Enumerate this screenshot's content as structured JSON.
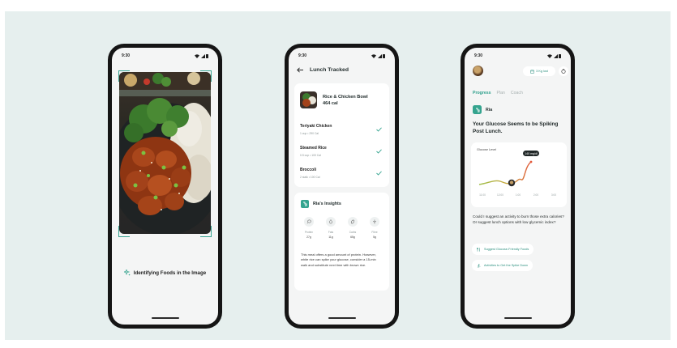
{
  "status_bar": {
    "time": "9:30"
  },
  "phone1": {
    "caption": "Identifying Foods in the Image"
  },
  "phone2": {
    "title": "Lunch Tracked",
    "meal": {
      "name": "Rice & Chicken Bowl",
      "calories": "464 cal"
    },
    "items": [
      {
        "name": "Teriyaki Chicken",
        "meta": "1 cup • 290 Cal"
      },
      {
        "name": "Steamed Rice",
        "meta": "0.5 cup • 100 Cal"
      },
      {
        "name": "Broccoli",
        "meta": "2 stalk • 100 Cal"
      }
    ],
    "insights": {
      "title": "Ria's Insights",
      "macros": [
        {
          "label": "Protein",
          "value": "27g",
          "icon": "drumstick-icon"
        },
        {
          "label": "Fats",
          "value": "11g",
          "icon": "drop-icon"
        },
        {
          "label": "Carbs",
          "value": "65g",
          "icon": "grain-icon"
        },
        {
          "label": "Fibre",
          "value": "5g",
          "icon": "leaf-icon"
        }
      ],
      "text": "This meal offers a good amount of protein. However, white rice can spike your glucose, consider a 15-min walk and substitute next time with brown rice."
    }
  },
  "phone3": {
    "log_label": "3 Kg lost",
    "tabs": [
      "Progress",
      "Plan",
      "Coach"
    ],
    "assistant_name": "Ria",
    "headline": "Your Glucose Seems to be Spiking Post Lunch.",
    "chart_label": "Glucose Level",
    "chart_tooltip": "140 mg/dl",
    "chart_ticks": [
      "11:00",
      "12:00",
      "1:00",
      "2:00",
      "3:00"
    ],
    "question": "Could I suggest an activity to burn those extra calories? Or suggest lunch options with low glycemic index?",
    "actions": [
      "Suggest Glucose-Friendly Foods",
      "Activities to Get the Spike Down"
    ]
  },
  "colors": {
    "accent": "#35a48f",
    "background": "#e6efee",
    "phone_frame": "#151515"
  }
}
